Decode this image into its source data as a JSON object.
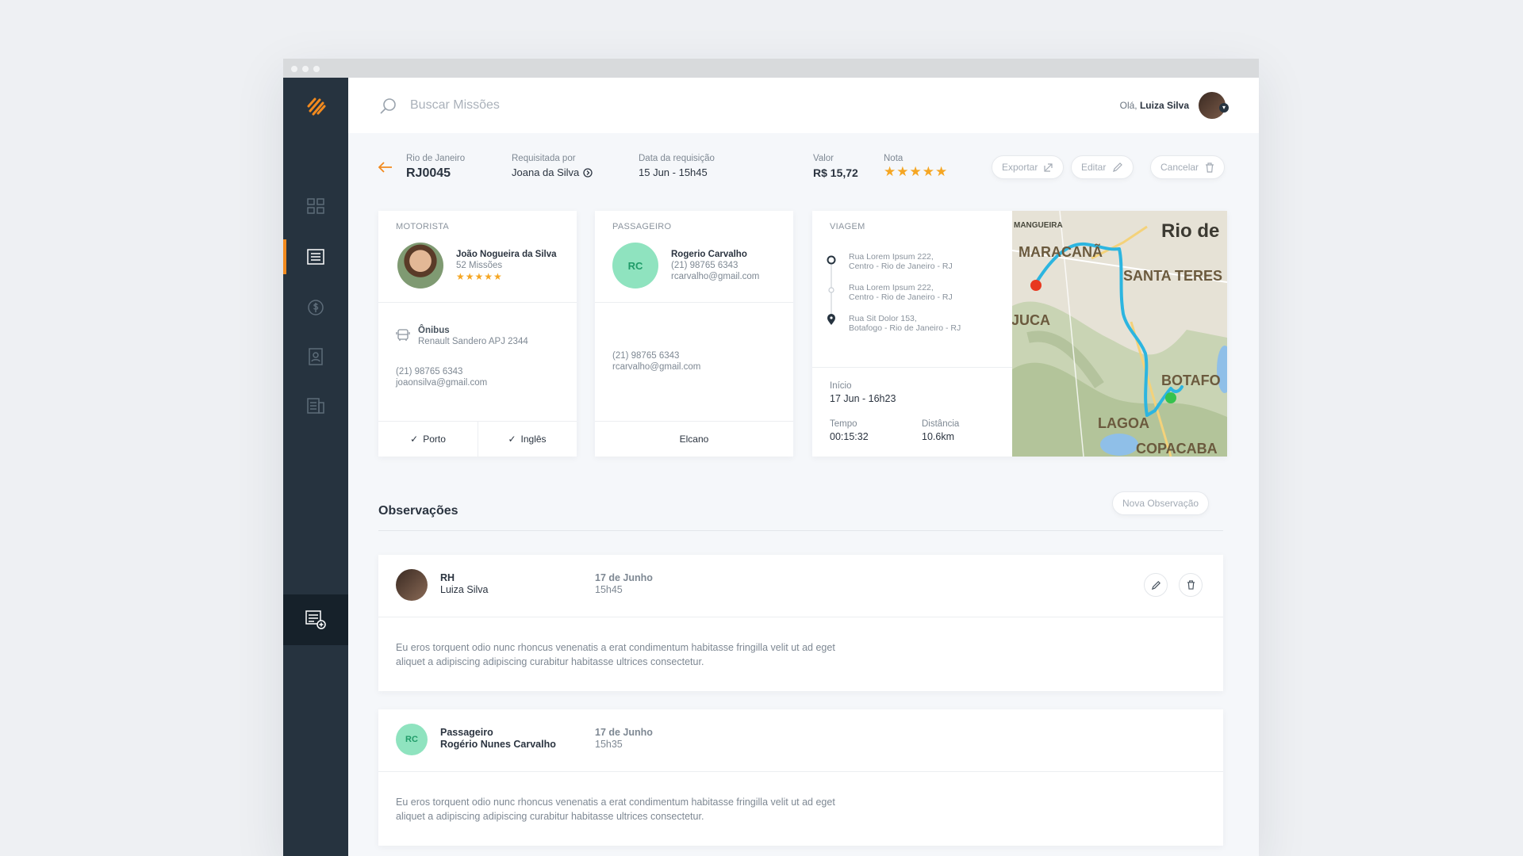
{
  "search": {
    "placeholder": "Buscar Missões"
  },
  "user": {
    "greeting_prefix": "Olá,",
    "name": "Luiza Silva"
  },
  "mission": {
    "city_label": "Rio de Janeiro",
    "code": "RJ0045",
    "requested_by_label": "Requisitada por",
    "requested_by": "Joana da Silva",
    "request_date_label": "Data da requisição",
    "request_date": "15 Jun - 15h45",
    "value_label": "Valor",
    "value": "R$ 15,72",
    "rating_label": "Nota",
    "rating": 5
  },
  "actions": {
    "export": "Exportar",
    "edit": "Editar",
    "cancel": "Cancelar"
  },
  "driver": {
    "title": "MOTORISTA",
    "name": "João Nogueira da Silva",
    "missions": "52 Missões",
    "rating": 5,
    "vehicle_type": "Ônibus",
    "vehicle": "Renault Sandero  APJ 2344",
    "phone": "(21) 98765 6343",
    "email": "joaonsilva@gmail.com",
    "tags": [
      "Porto",
      "Inglês"
    ]
  },
  "passenger": {
    "title": "PASSAGEIRO",
    "initials": "RC",
    "name": "Rogerio Carvalho",
    "phone": "(21) 98765 6343",
    "email": "rcarvalho@gmail.com",
    "phone2": "(21) 98765 6343",
    "email2": "rcarvalho@gmail.com",
    "footer": "Elcano"
  },
  "trip": {
    "title": "VIAGEM",
    "stops": [
      {
        "line1": "Rua Lorem Ipsum 222,",
        "line2": "Centro - Rio de Janeiro - RJ"
      },
      {
        "line1": "Rua Lorem Ipsum 222,",
        "line2": "Centro - Rio de Janeiro - RJ"
      },
      {
        "line1": "Rua Sit Dolor 153,",
        "line2": "Botafogo - Rio de Janeiro - RJ"
      }
    ],
    "start_label": "Início",
    "start": "17 Jun - 16h23",
    "time_label": "Tempo",
    "time": "00:15:32",
    "distance_label": "Distância",
    "distance": "10.6km"
  },
  "map": {
    "labels": [
      "MANGUEIRA",
      "Rio de",
      "MARACANÃ",
      "SANTA TERES",
      "IJUCA",
      "BOTAFO",
      "LAGOA",
      "COPACABA"
    ]
  },
  "observations": {
    "title": "Observações",
    "new_button": "Nova Observação",
    "items": [
      {
        "role": "RH",
        "name": "Luiza Silva",
        "date": "17 de Junho",
        "time": "15h45",
        "text1": "Eu eros torquent odio nunc rhoncus venenatis a erat condimentum habitasse fringilla velit ut ad eget",
        "text2": "aliquet a adipiscing adipiscing curabitur habitasse ultrices consectetur."
      },
      {
        "role": "Passageiro",
        "initials": "RC",
        "name": "Rogério Nunes Carvalho",
        "date": "17 de Junho",
        "time": "15h35",
        "text1": "Eu eros torquent odio nunc rhoncus venenatis a erat condimentum habitasse fringilla velit ut ad eget",
        "text2": "aliquet a adipiscing adipiscing curabitur habitasse ultrices consectetur."
      }
    ]
  },
  "colors": {
    "accent": "#f28a1e",
    "sidebar": "#26333f",
    "route": "#2cb5e0",
    "star": "#f5a623"
  }
}
